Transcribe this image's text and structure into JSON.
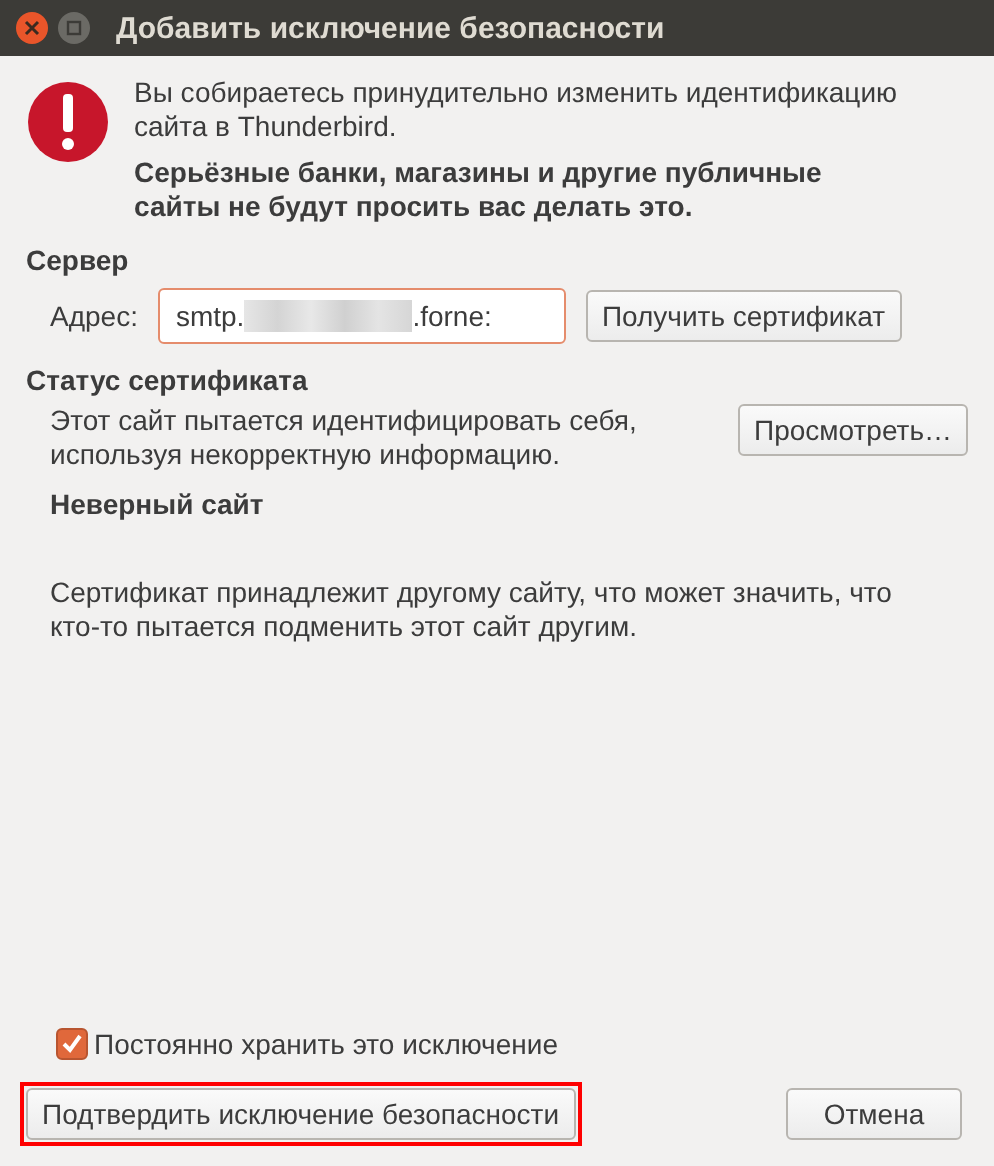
{
  "window": {
    "title": "Добавить исключение безопасности"
  },
  "warning": {
    "message": "Вы собираетесь принудительно изменить идентификацию сайта в Thunderbird.",
    "emphasis": "Серьёзные банки, магазины и другие публичные сайты не будут просить вас делать это."
  },
  "server": {
    "heading": "Сервер",
    "address_label": "Адрес:",
    "address_start": "smtp.",
    "address_end": ".forne:",
    "get_button": "Получить сертификат"
  },
  "status": {
    "heading": "Статус сертификата",
    "message": "Этот сайт пытается идентифицировать себя, используя некорректную информацию.",
    "view_button": "Просмотреть…",
    "problem_title": "Неверный сайт",
    "problem_text": "Сертификат принадлежит другому сайту, что может значить, что кто-то пытается подменить этот сайт другим."
  },
  "permanent": {
    "label": "Постоянно хранить это исключение",
    "checked": true
  },
  "buttons": [
    {
      "label": "Подтвердить исключение безопасности",
      "kind": "confirm",
      "highlighted": true
    },
    {
      "label": "Отмена",
      "kind": "cancel",
      "highlighted": false
    }
  ]
}
